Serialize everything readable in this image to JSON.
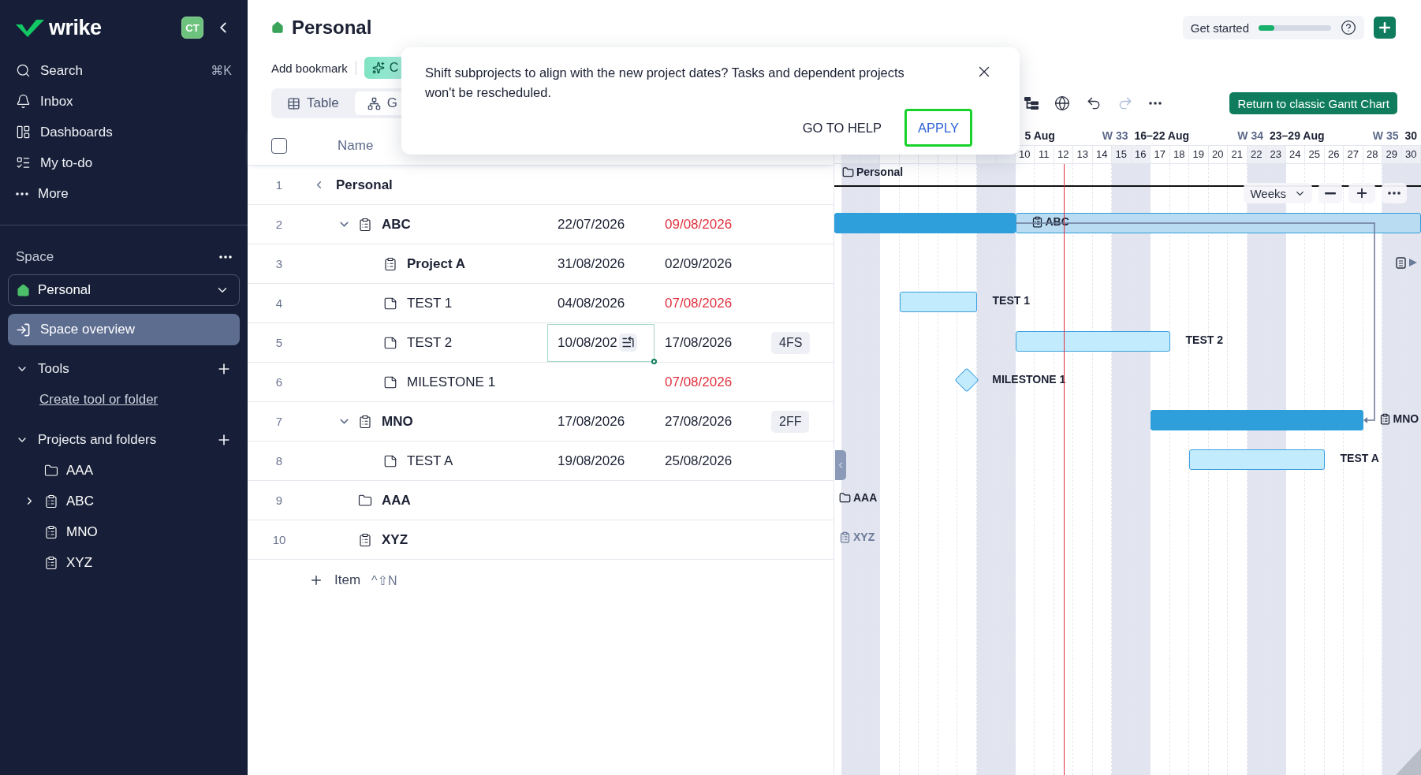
{
  "sidebar": {
    "logo": "wrike",
    "avatar": "CT",
    "nav": [
      {
        "label": "Search",
        "shortcut": "⌘K"
      },
      {
        "label": "Inbox"
      },
      {
        "label": "Dashboards"
      },
      {
        "label": "My to-do"
      },
      {
        "label": "More"
      }
    ],
    "space_label": "Space",
    "space_selector": "Personal",
    "overview": {
      "label": "Space overview",
      "selected": true
    },
    "tools": {
      "title": "Tools",
      "expanded": true,
      "link": "Create tool or folder"
    },
    "projects": {
      "title": "Projects and folders",
      "expanded": true,
      "items": [
        {
          "kind": "folder",
          "label": "AAA",
          "expandable": false
        },
        {
          "kind": "project",
          "label": "ABC",
          "expandable": true
        },
        {
          "kind": "project",
          "label": "MNO",
          "expandable": false
        },
        {
          "kind": "project",
          "label": "XYZ",
          "expandable": false
        }
      ]
    }
  },
  "header": {
    "title": "Personal",
    "bookmark": "Add bookmark",
    "chip": "C",
    "views": [
      {
        "label": "Table",
        "selected": false
      },
      {
        "label": "G",
        "selected": true
      }
    ],
    "get_started": {
      "label": "Get started",
      "level": 0.22
    }
  },
  "gantt_toolbar": {
    "tools": [
      {
        "disabled": false
      },
      {
        "disabled": false
      },
      {
        "disabled": false
      },
      {
        "disabled": true
      },
      {
        "disabled": false
      }
    ],
    "classic_button": "Return to classic Gantt Chart"
  },
  "dialog": {
    "message": "Shift subprojects to align with the new project dates? Tasks and dependent projects won't be rescheduled.",
    "actions": [
      {
        "label": "GO TO HELP",
        "focused": false
      },
      {
        "label": "APPLY",
        "focused": true
      }
    ]
  },
  "table": {
    "select_all_checked": false,
    "name_header": "Name",
    "add_item": "Item",
    "add_shortcut": "^⇧N",
    "rows": [
      {
        "number": "1",
        "kind": "root",
        "name": "Personal",
        "start_selected": false,
        "gantt": {
          "kind": "root",
          "label": "Personal"
        },
        "children": [
          {
            "number": "2",
            "kind": "project",
            "name": "ABC",
            "expanded": true,
            "start": "22/07/2026",
            "end": "09/08/2026",
            "overdue": true,
            "start_selected": false,
            "gantt": {
              "kind": "summary",
              "label": "ABC"
            },
            "children": [
              {
                "number": "3",
                "kind": "project",
                "name": "Project A",
                "start": "31/08/2026",
                "end": "02/09/2026",
                "overdue": false,
                "start_selected": false,
                "gantt": {
                  "kind": "offscreen"
                }
              },
              {
                "number": "4",
                "kind": "task",
                "name": "TEST 1",
                "start": "04/08/2026",
                "end": "07/08/2026",
                "overdue": true,
                "start_selected": false,
                "gantt": {
                  "kind": "task",
                  "label": "TEST 1"
                }
              },
              {
                "number": "5",
                "kind": "task",
                "name": "TEST 2",
                "start": "10/08/202",
                "end": "17/08/2026",
                "overdue": false,
                "dependency": "4FS",
                "start_selected": true,
                "gantt": {
                  "kind": "task",
                  "label": "TEST 2"
                }
              },
              {
                "number": "6",
                "kind": "task",
                "name": "MILESTONE 1",
                "end": "07/08/2026",
                "overdue": true,
                "start_selected": false,
                "gantt": {
                  "kind": "milestone",
                  "label": "MILESTONE 1"
                }
              }
            ]
          },
          {
            "number": "7",
            "kind": "project",
            "name": "MNO",
            "expanded": true,
            "start": "17/08/2026",
            "end": "27/08/2026",
            "overdue": false,
            "dependency": "2FF",
            "start_selected": false,
            "gantt": {
              "kind": "summary",
              "label": "MNO"
            },
            "children": [
              {
                "number": "8",
                "kind": "task",
                "name": "TEST A",
                "start": "19/08/2026",
                "end": "25/08/2026",
                "overdue": false,
                "start_selected": false,
                "gantt": {
                  "kind": "task",
                  "label": "TEST A"
                }
              }
            ]
          },
          {
            "number": "9",
            "kind": "folder",
            "name": "AAA",
            "start_selected": false,
            "gantt": {
              "kind": "folder",
              "label": "AAA"
            }
          },
          {
            "number": "10",
            "kind": "project",
            "name": "XYZ",
            "start_selected": false,
            "gantt": {
              "kind": "empty",
              "label": "XYZ"
            }
          }
        ]
      }
    ]
  },
  "timeline": {
    "scale": "Weeks",
    "weeks": [
      {
        "range": "5 Aug",
        "number": "W 33"
      },
      {
        "range": "16–22 Aug",
        "number": "W 34"
      },
      {
        "range": "23–29 Aug",
        "number": "W 35"
      },
      {
        "range": "30"
      }
    ],
    "days": [
      {
        "weekend": true,
        "today": false
      },
      {
        "weekend": true,
        "today": false
      },
      {
        "weekend": false,
        "today": false
      },
      {
        "weekend": false,
        "today": false
      },
      {
        "weekend": false,
        "today": false
      },
      {
        "weekend": false,
        "today": false
      },
      {
        "weekend": false,
        "today": false
      },
      {
        "weekend": true,
        "today": false
      },
      {
        "weekend": true,
        "today": false
      },
      {
        "label": "10",
        "weekend": false,
        "today": false
      },
      {
        "label": "11",
        "weekend": false,
        "today": false
      },
      {
        "label": "12",
        "weekend": false,
        "today": true
      },
      {
        "label": "13",
        "weekend": false,
        "today": false
      },
      {
        "label": "14",
        "weekend": false,
        "today": false
      },
      {
        "label": "15",
        "weekend": true,
        "today": false
      },
      {
        "label": "16",
        "weekend": true,
        "today": false
      },
      {
        "label": "17",
        "weekend": false,
        "today": false
      },
      {
        "label": "18",
        "weekend": false,
        "today": false
      },
      {
        "label": "19",
        "weekend": false,
        "today": false
      },
      {
        "label": "20",
        "weekend": false,
        "today": false
      },
      {
        "label": "21",
        "weekend": false,
        "today": false
      },
      {
        "label": "22",
        "weekend": true,
        "today": false
      },
      {
        "label": "23",
        "weekend": true,
        "today": false
      },
      {
        "label": "24",
        "weekend": false,
        "today": false
      },
      {
        "label": "25",
        "weekend": false,
        "today": false
      },
      {
        "label": "26",
        "weekend": false,
        "today": false
      },
      {
        "label": "27",
        "weekend": false,
        "today": false
      },
      {
        "label": "28",
        "weekend": false,
        "today": false
      },
      {
        "label": "29",
        "weekend": true,
        "today": false
      },
      {
        "label": "30",
        "weekend": true,
        "today": false
      }
    ]
  }
}
